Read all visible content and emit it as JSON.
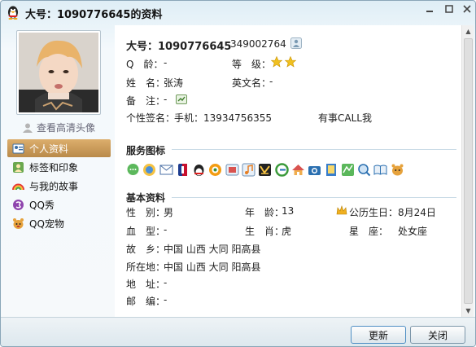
{
  "window": {
    "title": "大号：1090776645的资料"
  },
  "left": {
    "view_hd_label": "查看高清头像",
    "nav": [
      {
        "label": "个人资料",
        "icon": "id-card-icon",
        "active": true
      },
      {
        "label": "标签和印象",
        "icon": "tag-person-icon",
        "active": false
      },
      {
        "label": "与我的故事",
        "icon": "rainbow-icon",
        "active": false
      },
      {
        "label": "QQ秀",
        "icon": "qq-show-icon",
        "active": false
      },
      {
        "label": "QQ宠物",
        "icon": "qq-pet-icon",
        "active": false
      }
    ]
  },
  "profile": {
    "name_label": "大号：",
    "qq_number": "1090776645",
    "alt_number": "349002764",
    "age_label": "Q　龄：",
    "age_value": "-",
    "level_label": "等　级：",
    "name_field_label": "姓　名：",
    "name_field_value": "张涛",
    "english_label": "英文名：",
    "english_value": "-",
    "remark_label": "备　注：",
    "remark_value": "-",
    "signature_label": "个性签名：",
    "signature_value": "手机：13934756355",
    "signature_extra": "有事CALL我"
  },
  "services": {
    "title": "服务图标",
    "icons": [
      "chat-bubble-icon",
      "globe-icon",
      "mail-icon",
      "nba-icon",
      "qq-vip-icon",
      "paipai-icon",
      "game-icon",
      "music-icon",
      "black-diamond-icon",
      "browser-icon",
      "home-icon",
      "camera-icon",
      "book-icon",
      "map-icon",
      "search-qq-icon",
      "reader-icon",
      "pet-icon"
    ]
  },
  "basic": {
    "title": "基本资料",
    "gender_label": "性　别：",
    "gender_value": "男",
    "age_label": "年　龄：",
    "age_value": "13",
    "birthday_label": "公历生日：",
    "birthday_value": "8月24日",
    "blood_label": "血　型：",
    "blood_value": "-",
    "zodiac_label": "生　肖：",
    "zodiac_value": "虎",
    "star_label": "星　座：",
    "star_value": "处女座",
    "hometown_label": "故　乡：",
    "hometown_value": "中国 山西 大同 阳高县",
    "location_label": "所在地：",
    "location_value": "中国 山西 大同 阳高县",
    "address_label": "地　址：",
    "address_value": "-",
    "postal_label": "邮　编：",
    "postal_value": "-"
  },
  "buttons": {
    "refresh": "更新",
    "close": "关闭"
  },
  "colors": {
    "nav_active": "#c9985a",
    "star": "#f0c020",
    "rule": "#c9dbe6"
  }
}
